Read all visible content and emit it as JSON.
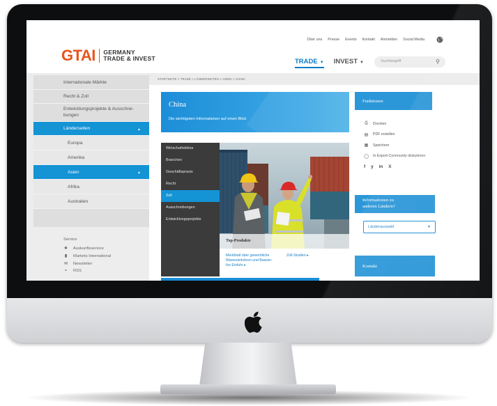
{
  "header": {
    "topnav": [
      "Über uns",
      "Presse",
      "Events",
      "Kontakt",
      "Anmelden",
      "Social Media"
    ],
    "logo": {
      "mark": "GTAI",
      "line1": "GERMANY",
      "line2": "TRADE & INVEST"
    },
    "mainnav": [
      {
        "label": "TRADE",
        "caret": "▼"
      },
      {
        "label": "INVEST",
        "caret": "▼"
      }
    ],
    "search": {
      "placeholder": "Suchbegriff"
    }
  },
  "sidebar": {
    "items": [
      {
        "label": "Internationale Märkte"
      },
      {
        "label": "Recht & Zoll"
      },
      {
        "label_line1": "Entwicklungsprojekte & Ausschrei-",
        "label_line2": "bungen"
      },
      {
        "label": "Länderseiten",
        "caret": "▲"
      },
      {
        "label": "Europa"
      },
      {
        "label": "Amerika"
      },
      {
        "label": "Asien",
        "caret": "▲"
      },
      {
        "label": "Afrika"
      },
      {
        "label": "Australien"
      }
    ],
    "service": {
      "title": "Service",
      "items": [
        "Auskunftsservice",
        "Markets International",
        "Newsletter",
        "RSS"
      ]
    }
  },
  "breadcrumb": "STARTSEITE > TRADE > LÄNDERSEITEN > ASIEN > CHINA",
  "hero": {
    "title": "China",
    "subtitle": "Die wichtigsten Informationen auf einen Blick"
  },
  "country_menu": {
    "items": [
      "Wirtschaftsklima",
      "Branchen",
      "Geschäftspraxis",
      "Recht",
      "Zoll",
      "Ausschreibungen",
      "Entwicklungsprojekte"
    ],
    "active": "Zoll"
  },
  "top_produkte": {
    "title": "Top-Produkte",
    "link1": "Merkblatt über gewerbliche Warenein­fuhren und Basisinfo zu Ein­fuhr ▸",
    "link1_line1": "Merkblatt über gewerbliche",
    "link1_line2": "Wareneinfuhren und Basisin-",
    "link1_line3": "fos Einfuhr ▸",
    "link2": "Zoll-Studien ▸"
  },
  "funktionen": {
    "title": "Funktionen",
    "items": [
      "Drucken",
      "PDF erstellen",
      "Speichern",
      "In Export-Community diskutieren"
    ],
    "social": [
      "f",
      "y",
      "in",
      "X"
    ]
  },
  "info_panel": {
    "title_line1": "Informationen zu",
    "title_line2": "anderen Ländern?",
    "select_value": "Länderauswahl"
  },
  "kontakt": {
    "title": "Kontakt"
  },
  "colors": {
    "brand_orange": "#e8541c",
    "accent_blue": "#1493d5",
    "dark_menu": "#3b3b3b"
  }
}
